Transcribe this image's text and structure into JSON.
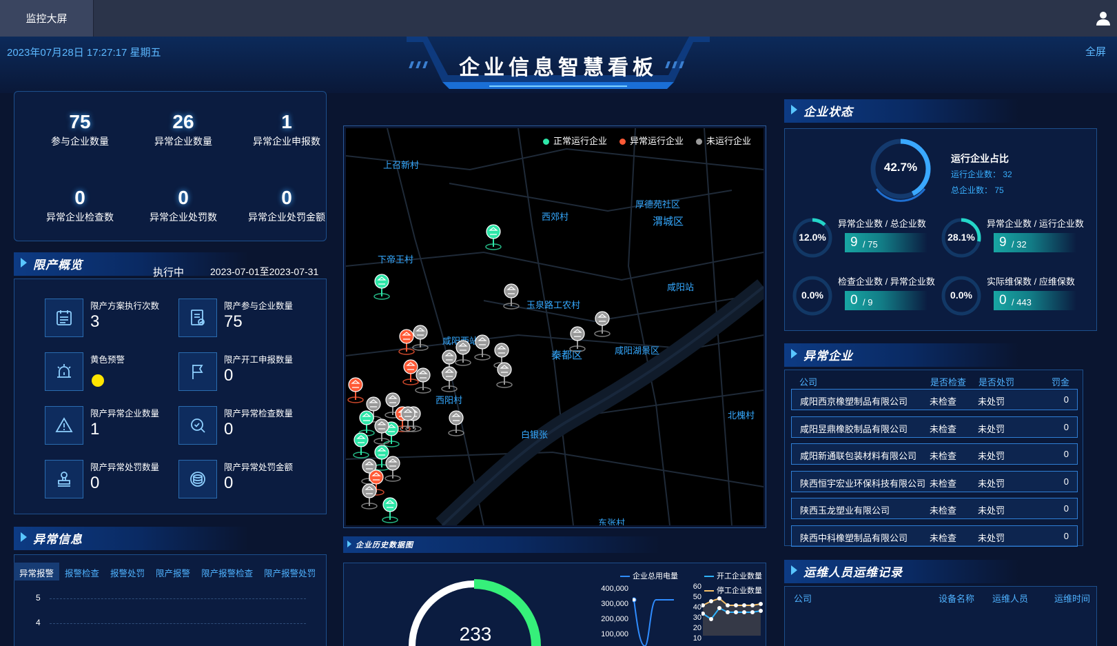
{
  "topbar": {
    "tab_label": "监控大屏"
  },
  "header": {
    "datetime": "2023年07月28日 17:27:17 星期五",
    "title": "企业信息智慧看板",
    "fullscreen": "全屏"
  },
  "stats": [
    {
      "value": "75",
      "label": "参与企业数量"
    },
    {
      "value": "26",
      "label": "异常企业数量"
    },
    {
      "value": "1",
      "label": "异常企业申报数"
    },
    {
      "value": "0",
      "label": "异常企业检查数"
    },
    {
      "value": "0",
      "label": "异常企业处罚数"
    },
    {
      "value": "0",
      "label": "异常企业处罚金额"
    }
  ],
  "limit": {
    "title": "限产概览",
    "status": "执行中",
    "period": "2023-07-01至2023-07-31",
    "items": [
      {
        "label": "限产方案执行次数",
        "value": "3",
        "icon": "calendar-icon"
      },
      {
        "label": "限产参与企业数量",
        "value": "75",
        "icon": "document-check-icon"
      },
      {
        "label": "黄色预警",
        "value": "",
        "icon": "alarm-icon"
      },
      {
        "label": "限产开工申报数量",
        "value": "0",
        "icon": "flag-icon"
      },
      {
        "label": "限产异常企业数量",
        "value": "1",
        "icon": "warning-icon"
      },
      {
        "label": "限产异常检查数量",
        "value": "0",
        "icon": "search-check-icon"
      },
      {
        "label": "限产异常处罚数量",
        "value": "0",
        "icon": "stamp-icon"
      },
      {
        "label": "限产异常处罚金额",
        "value": "0",
        "icon": "coins-icon"
      }
    ],
    "warning_color": "#ffe500"
  },
  "abnormal_info": {
    "title": "异常信息",
    "tabs": [
      "异常报警",
      "报警检查",
      "报警处罚",
      "限产报警",
      "限产报警检查",
      "限产报警处罚"
    ],
    "y_ticks": [
      "5",
      "4"
    ]
  },
  "map": {
    "legend": [
      {
        "label": "正常运行企业",
        "color": "#2ee6a8"
      },
      {
        "label": "异常运行企业",
        "color": "#ff5a36"
      },
      {
        "label": "未运行企业",
        "color": "#9a9a9a"
      }
    ],
    "places": [
      "上召新村",
      "西郊村",
      "厚德苑社区",
      "渭城区",
      "下帝王村",
      "咸阳站",
      "玉泉路工农村",
      "咸阳西站",
      "秦都区",
      "咸阳湖景区",
      "西阳村",
      "北槐村",
      "白银张",
      "东张村"
    ]
  },
  "history": {
    "title": "企业历史数据图",
    "gauge_value": "233",
    "legend_left": "企业总用电量",
    "legend_right": [
      "开工企业数量",
      "停工企业数量"
    ],
    "left_ticks": [
      "400,000",
      "300,000",
      "200,000",
      "100,000"
    ],
    "right_ticks": [
      "60",
      "50",
      "40",
      "30",
      "20",
      "10"
    ]
  },
  "status": {
    "title": "企业状态",
    "main_percent": "42.7%",
    "main_title": "运行企业占比",
    "running_label": "运行企业数：",
    "running_value": "32",
    "total_label": "总企业数：",
    "total_value": "75",
    "main_fraction": 0.427,
    "ratios": [
      {
        "percent": "12.0%",
        "label": "异常企业数 / 总企业数",
        "num": "9",
        "den": "/ 75",
        "fraction": 0.12
      },
      {
        "percent": "28.1%",
        "label": "异常企业数 / 运行企业数",
        "num": "9",
        "den": "/ 32",
        "fraction": 0.281
      },
      {
        "percent": "0.0%",
        "label": "检查企业数 / 异常企业数",
        "num": "0",
        "den": "/ 9",
        "fraction": 0
      },
      {
        "percent": "0.0%",
        "label": "实际维保数 / 应维保数",
        "num": "0",
        "den": "/ 443",
        "fraction": 0
      }
    ]
  },
  "abnormal_enterprise": {
    "title": "异常企业",
    "headers": [
      "公司",
      "是否检查",
      "是否处罚",
      "罚金"
    ],
    "rows": [
      [
        "咸阳西京橡塑制品有限公司",
        "未检查",
        "未处罚",
        "0"
      ],
      [
        "咸阳昱鼎橡胶制品有限公司",
        "未检查",
        "未处罚",
        "0"
      ],
      [
        "咸阳新通联包装材料有限公司",
        "未检查",
        "未处罚",
        "0"
      ],
      [
        "陕西恒宇宏业环保科技有限公司",
        "未检查",
        "未处罚",
        "0"
      ],
      [
        "陕西玉龙塑业有限公司",
        "未检查",
        "未处罚",
        "0"
      ],
      [
        "陕西中科橡塑制品有限公司",
        "未检查",
        "未处罚",
        "0"
      ]
    ]
  },
  "maintenance": {
    "title": "运维人员运维记录",
    "headers": [
      "公司",
      "设备名称",
      "运维人员",
      "运维时间"
    ]
  }
}
